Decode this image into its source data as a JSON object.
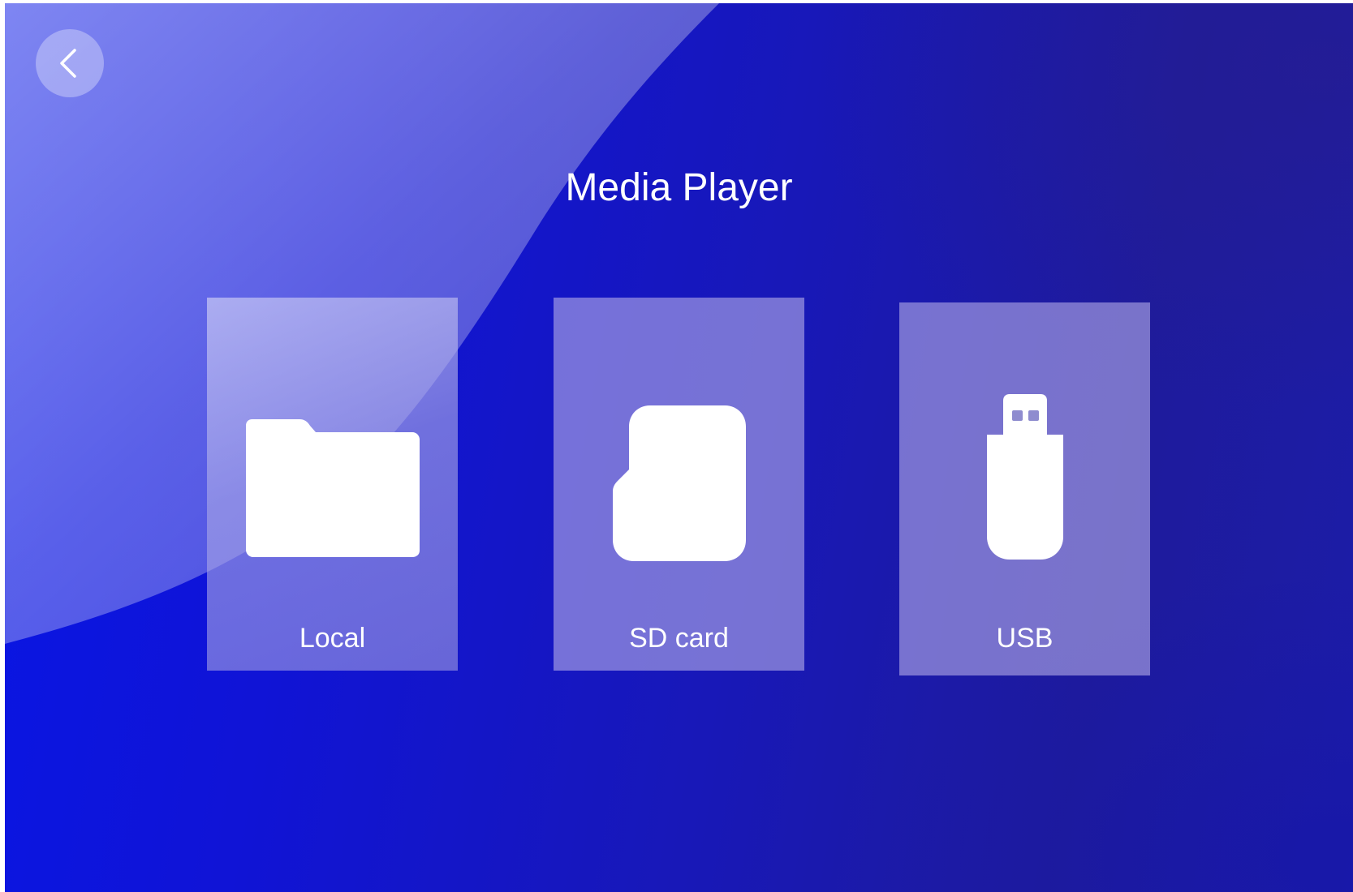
{
  "app": {
    "title": "Media Player"
  },
  "header": {
    "back_icon": "chevron-left-icon"
  },
  "sources": [
    {
      "label": "Local",
      "icon": "folder-icon"
    },
    {
      "label": "SD card",
      "icon": "sd-card-icon"
    },
    {
      "label": "USB",
      "icon": "usb-drive-icon"
    }
  ],
  "colors": {
    "background_primary": "#0a16e0",
    "background_secondary": "#1e1b9c",
    "card_fill": "#b2aae6",
    "text": "#ffffff"
  }
}
